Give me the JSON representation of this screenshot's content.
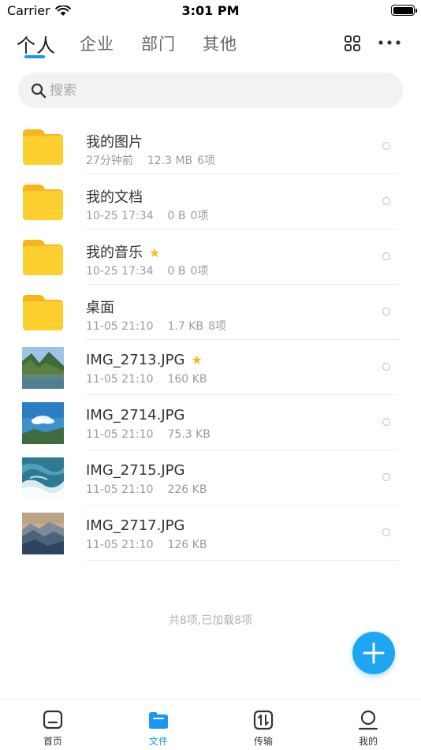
{
  "status_bar": {
    "carrier": "Carrier",
    "time": "3:01 PM",
    "battery_level": 1.0
  },
  "tabs": [
    {
      "label": "个人",
      "active": true
    },
    {
      "label": "企业",
      "active": false
    },
    {
      "label": "部门",
      "active": false
    },
    {
      "label": "其他",
      "active": false
    }
  ],
  "toolbar": {
    "grid_icon": "grid-view-icon",
    "more_icon": "more-dots-icon"
  },
  "search": {
    "placeholder": "搜索",
    "value": ""
  },
  "files": [
    {
      "name": "我的图片",
      "starred": false,
      "type": "folder",
      "meta1": "27分钟前",
      "meta2": "12.3 MB",
      "meta3": "6项"
    },
    {
      "name": "我的文档",
      "starred": false,
      "type": "folder",
      "meta1": "10-25 17:34",
      "meta2": "0 B",
      "meta3": "0项"
    },
    {
      "name": "我的音乐",
      "starred": true,
      "type": "folder",
      "meta1": "10-25 17:34",
      "meta2": "0 B",
      "meta3": "0项"
    },
    {
      "name": "桌面",
      "starred": false,
      "type": "folder",
      "meta1": "11-05 21:10",
      "meta2": "1.7 KB",
      "meta3": "8项"
    },
    {
      "name": "IMG_2713.JPG",
      "starred": true,
      "type": "image-lake",
      "meta1": "11-05 21:10",
      "meta2": "160 KB",
      "meta3": ""
    },
    {
      "name": "IMG_2714.JPG",
      "starred": false,
      "type": "image-sky",
      "meta1": "11-05 21:10",
      "meta2": "75.3 KB",
      "meta3": ""
    },
    {
      "name": "IMG_2715.JPG",
      "starred": false,
      "type": "image-waves",
      "meta1": "11-05 21:10",
      "meta2": "226 KB",
      "meta3": ""
    },
    {
      "name": "IMG_2717.JPG",
      "starred": false,
      "type": "image-mountains",
      "meta1": "11-05 21:10",
      "meta2": "126 KB",
      "meta3": ""
    }
  ],
  "footer_total": "共8项,已加载8项",
  "fab": {
    "icon": "plus-icon"
  },
  "bottom_nav": [
    {
      "label": "首页",
      "icon": "home-icon",
      "active": false
    },
    {
      "label": "文件",
      "icon": "folder-icon",
      "active": true
    },
    {
      "label": "传输",
      "icon": "transfer-icon",
      "active": false
    },
    {
      "label": "我的",
      "icon": "profile-icon",
      "active": false
    }
  ],
  "colors": {
    "accent": "#1a97f0",
    "folder": "#fdd02f",
    "star": "#f6b928"
  }
}
